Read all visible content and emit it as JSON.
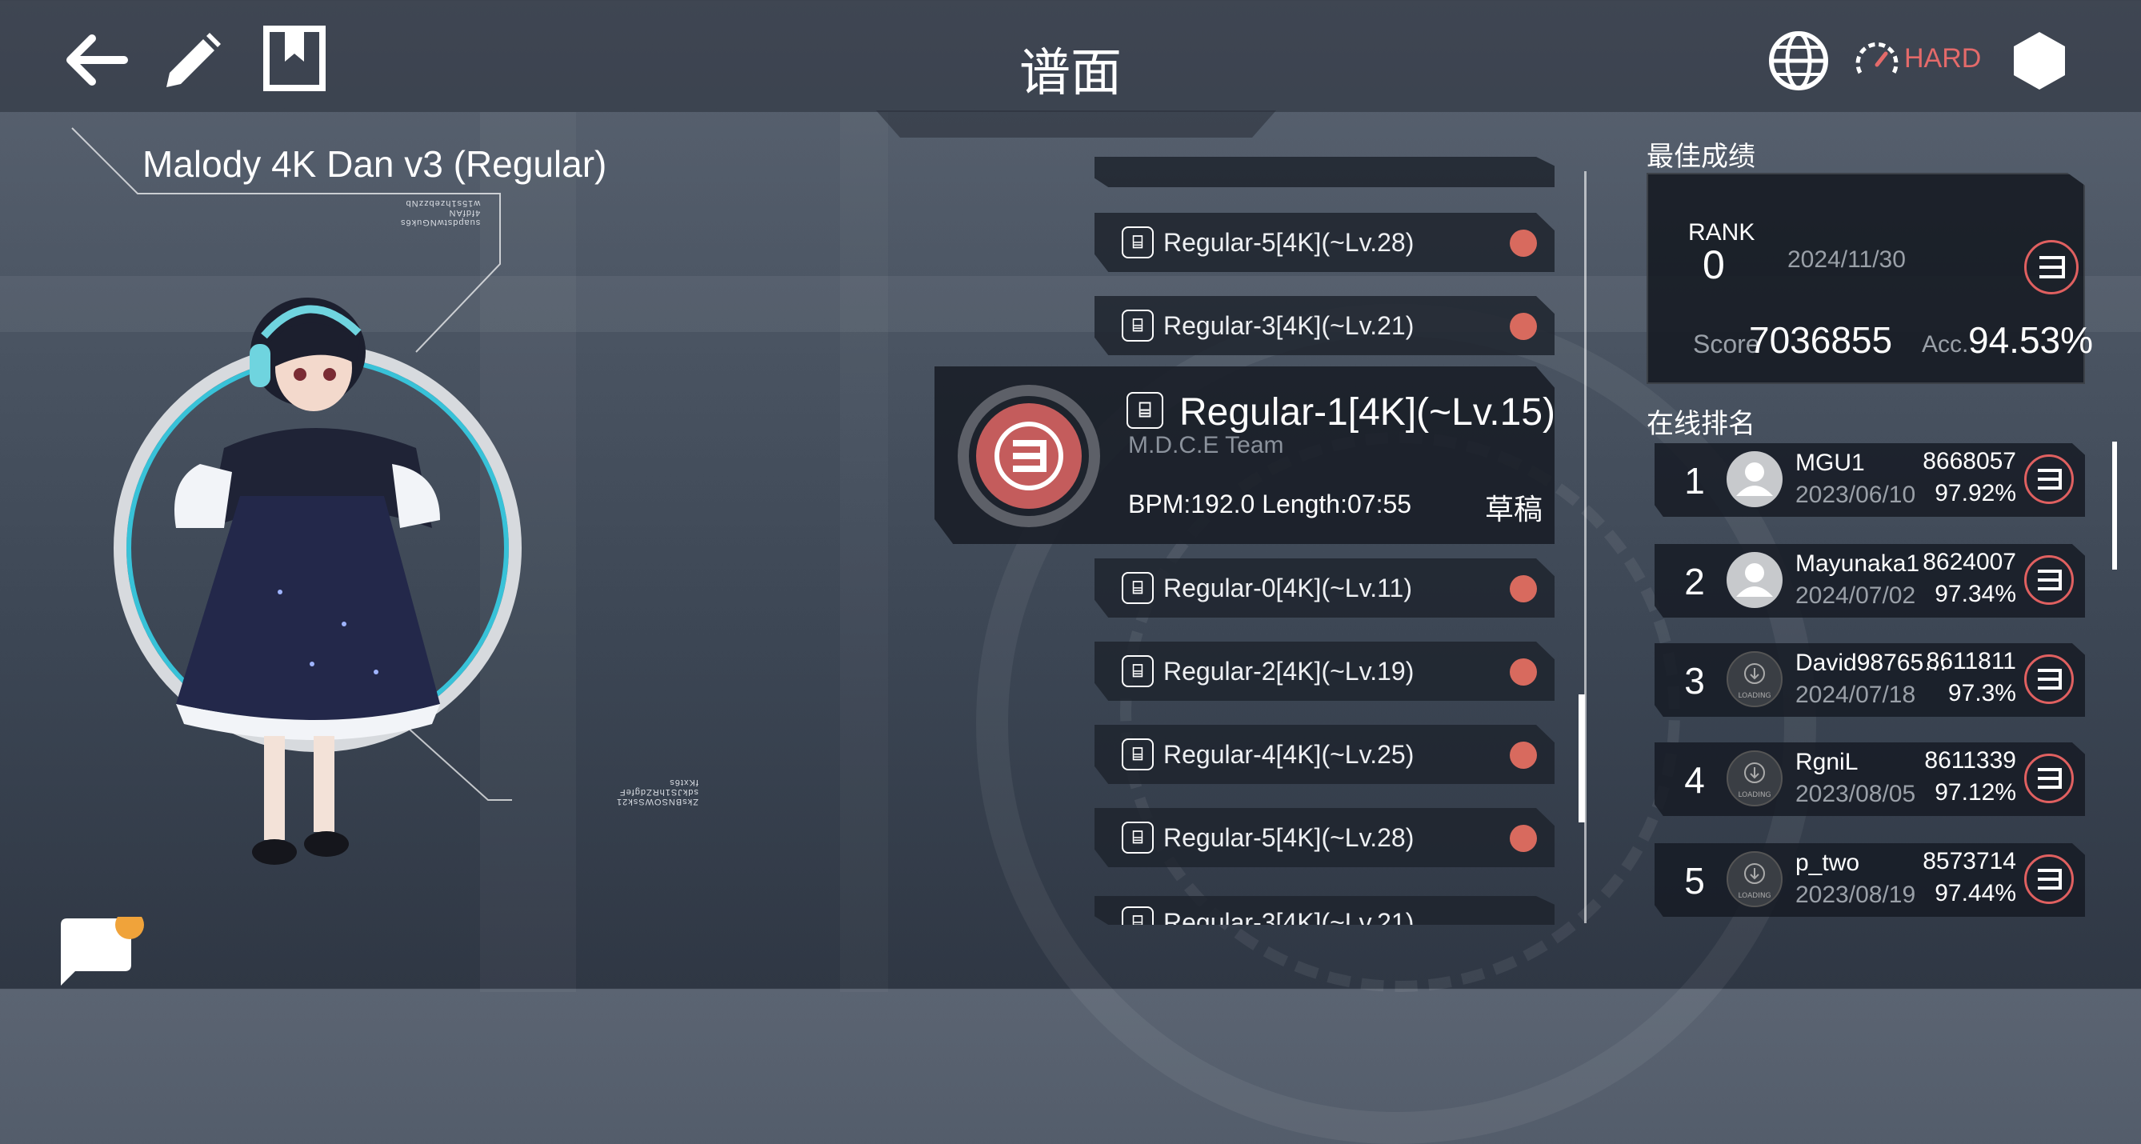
{
  "header": {
    "title": "谱面",
    "difficulty_label": "HARD",
    "icons": [
      "back-arrow-icon",
      "edit-pencil-icon",
      "bookmark-icon",
      "globe-icon",
      "speedometer-icon",
      "hexagon-icon"
    ]
  },
  "song": {
    "title": "Malody 4K Dan v3 (Regular)",
    "tiny_text_top": [
      "suapdstwNGuk6s",
      "4fdfAN",
      "w15s1hzebzzNb"
    ],
    "tiny_text_bottom": [
      "ZksBNSOWSsk21",
      "sdkJS1hRZdgfeF",
      "fKxt6s"
    ]
  },
  "charts": [
    {
      "label": "Regular-5[4K](~Lv.28)"
    },
    {
      "label": "Regular-3[4K](~Lv.21)"
    },
    {
      "label": "Regular-0[4K](~Lv.11)"
    },
    {
      "label": "Regular-2[4K](~Lv.19)"
    },
    {
      "label": "Regular-4[4K](~Lv.25)"
    },
    {
      "label": "Regular-5[4K](~Lv.28)"
    },
    {
      "label": "Regular-3[4K](~Lv.21)"
    }
  ],
  "selected_chart": {
    "title": "Regular-1[4K](~Lv.15)",
    "creator": "M.D.C.E Team",
    "bpm_length": "BPM:192.0  Length:07:55",
    "status": "草稿"
  },
  "best": {
    "section_title": "最佳成绩",
    "rank_label": "RANK",
    "rank_value": "0",
    "date": "2024/11/30",
    "score_label": "Score",
    "score_value": "7036855",
    "acc_label": "Acc.",
    "acc_value": "94.53%"
  },
  "online": {
    "section_title": "在线排名",
    "rows": [
      {
        "rank": "1",
        "name": "MGU1",
        "date": "2023/06/10",
        "score": "8668057",
        "acc": "97.92%",
        "avatar": "person"
      },
      {
        "rank": "2",
        "name": "Mayunaka1",
        "date": "2024/07/02",
        "score": "8624007",
        "acc": "97.34%",
        "avatar": "person"
      },
      {
        "rank": "3",
        "name": "David98765…",
        "date": "2024/07/18",
        "score": "8611811",
        "acc": "97.3%",
        "avatar": "loading"
      },
      {
        "rank": "4",
        "name": "RgniL",
        "date": "2023/08/05",
        "score": "8611339",
        "acc": "97.12%",
        "avatar": "loading"
      },
      {
        "rank": "5",
        "name": "p_two",
        "date": "2023/08/19",
        "score": "8573714",
        "acc": "97.44%",
        "avatar": "loading"
      }
    ]
  },
  "colors": {
    "accent_red": "#d86a5e",
    "cyan_ring": "#38c2d8"
  }
}
